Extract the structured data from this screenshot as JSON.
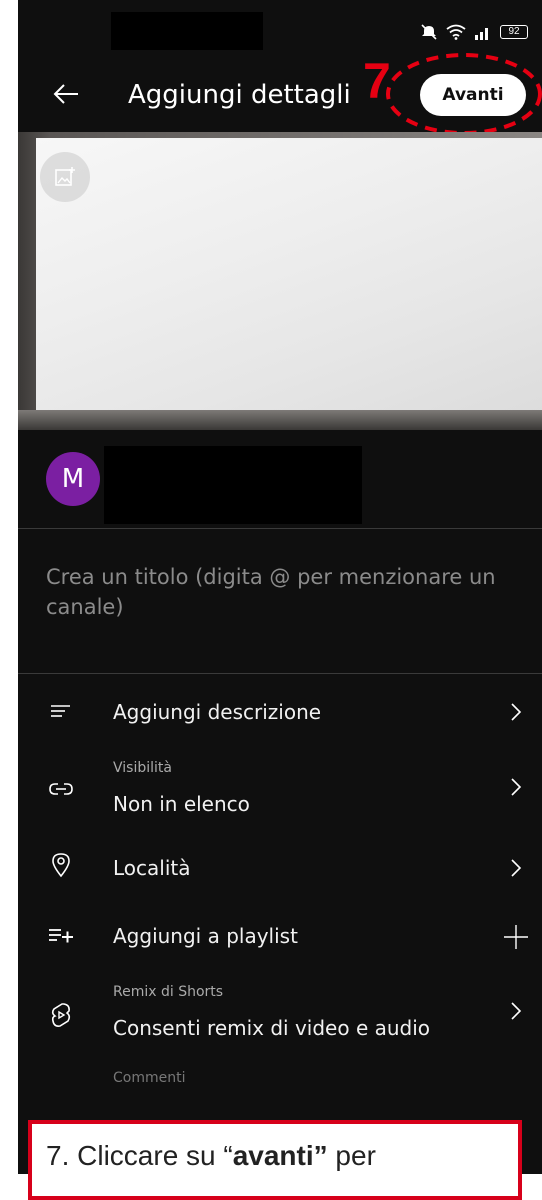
{
  "status_bar": {
    "battery": "92"
  },
  "header": {
    "title": "Aggiungi dettagli",
    "next_button": "Avanti",
    "annotation_number": "7"
  },
  "channel": {
    "avatar_letter": "M"
  },
  "title_field": {
    "placeholder": "Crea un titolo (digita @ per menzionare un canale)"
  },
  "settings": {
    "description": {
      "label": "Aggiungi descrizione",
      "icon": "description-lines-icon"
    },
    "visibility": {
      "sublabel": "Visibilità",
      "label": "Non in elenco",
      "icon": "link-icon"
    },
    "location": {
      "label": "Località",
      "icon": "location-pin-icon"
    },
    "playlist": {
      "label": "Aggiungi a playlist",
      "icon": "playlist-add-icon"
    },
    "remix": {
      "sublabel": "Remix di Shorts",
      "label": "Consenti remix di video e audio",
      "icon": "shorts-remix-icon"
    },
    "comments": {
      "sublabel": "Commenti"
    }
  },
  "caption": {
    "prefix": "7. Cliccare su “",
    "bold": "avanti”",
    "suffix": " per"
  },
  "colors": {
    "background": "#0f0f0f",
    "annotation_red": "#e60012",
    "avatar_purple": "#7b1fa2"
  }
}
